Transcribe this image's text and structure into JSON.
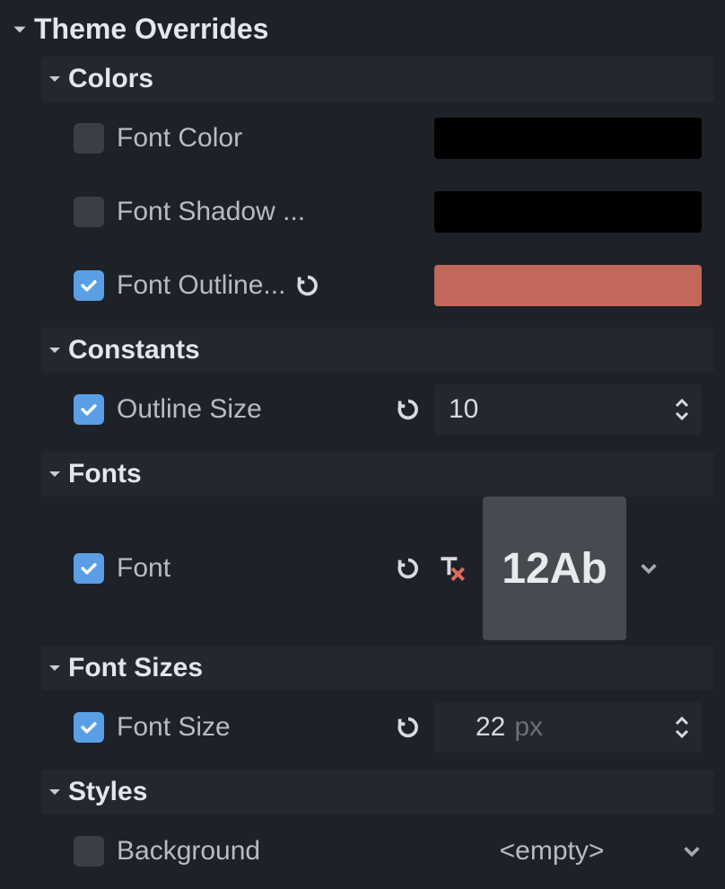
{
  "main": {
    "title": "Theme Overrides"
  },
  "colors": {
    "title": "Colors",
    "font_color": {
      "label": "Font Color",
      "checked": false,
      "swatch": "#000000"
    },
    "font_shadow": {
      "label": "Font Shadow ...",
      "checked": false,
      "swatch": "#000000"
    },
    "font_outline": {
      "label": "Font Outline...",
      "checked": true,
      "swatch": "#c1685a"
    }
  },
  "constants": {
    "title": "Constants",
    "outline_size": {
      "label": "Outline Size",
      "checked": true,
      "value": "10"
    }
  },
  "fonts": {
    "title": "Fonts",
    "font": {
      "label": "Font",
      "checked": true,
      "preview": "12Ab"
    }
  },
  "font_sizes": {
    "title": "Font Sizes",
    "font_size": {
      "label": "Font Size",
      "checked": true,
      "value": "22",
      "unit": "px"
    }
  },
  "styles": {
    "title": "Styles",
    "background": {
      "label": "Background",
      "checked": false,
      "value": "<empty>"
    }
  }
}
